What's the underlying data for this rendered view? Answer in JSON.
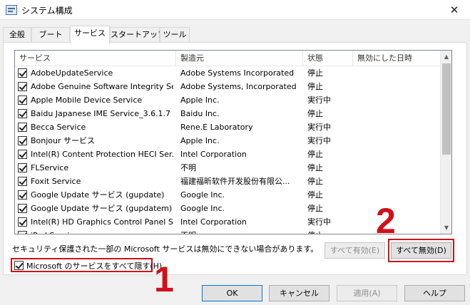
{
  "window": {
    "title": "システム構成",
    "close_glyph": "✕"
  },
  "tabs": [
    {
      "label": "全般"
    },
    {
      "label": "ブート"
    },
    {
      "label": "サービス"
    },
    {
      "label": "スタートアップ"
    },
    {
      "label": "ツール"
    }
  ],
  "list": {
    "columns": [
      "サービス",
      "製造元",
      "状態",
      "無効にした日時"
    ],
    "rows": [
      {
        "checked": true,
        "name": "AdobeUpdateService",
        "manufacturer": "Adobe Systems Incorporated",
        "status": "停止",
        "date": ""
      },
      {
        "checked": true,
        "name": "Adobe Genuine Software Integrity Se...",
        "manufacturer": "Adobe Systems, Incorporated",
        "status": "停止",
        "date": ""
      },
      {
        "checked": true,
        "name": "Apple Mobile Device Service",
        "manufacturer": "Apple Inc.",
        "status": "実行中",
        "date": ""
      },
      {
        "checked": true,
        "name": "Baidu Japanese IME Service_3.6.1.7",
        "manufacturer": "Baidu Inc.",
        "status": "停止",
        "date": ""
      },
      {
        "checked": true,
        "name": "Becca Service",
        "manufacturer": "Rene.E Laboratory",
        "status": "実行中",
        "date": ""
      },
      {
        "checked": true,
        "name": "Bonjour サービス",
        "manufacturer": "Apple Inc.",
        "status": "実行中",
        "date": ""
      },
      {
        "checked": true,
        "name": "Intel(R) Content Protection HECI Ser...",
        "manufacturer": "Intel Corporation",
        "status": "停止",
        "date": ""
      },
      {
        "checked": true,
        "name": "FLService",
        "manufacturer": "不明",
        "status": "停止",
        "date": ""
      },
      {
        "checked": true,
        "name": "Foxit Service",
        "manufacturer": "福建福昕软件开发股份有限公...",
        "status": "停止",
        "date": ""
      },
      {
        "checked": true,
        "name": "Google Update サービス (gupdate)",
        "manufacturer": "Google Inc.",
        "status": "停止",
        "date": ""
      },
      {
        "checked": true,
        "name": "Google Update サービス (gupdatem)",
        "manufacturer": "Google Inc.",
        "status": "停止",
        "date": ""
      },
      {
        "checked": true,
        "name": "Intel(R) HD Graphics Control Panel S...",
        "manufacturer": "Intel Corporation",
        "status": "実行中",
        "date": ""
      },
      {
        "checked": true,
        "name": "iPod Service",
        "manufacturer": "不明",
        "status": "停止",
        "date": ""
      }
    ]
  },
  "notice": "セキュリティ保護された一部の Microsoft サービスは無効にできない場合があります。",
  "buttons": {
    "enable_all": "すべて有効(E)",
    "disable_all": "すべて無効(D)",
    "ok": "OK",
    "cancel": "キャンセル",
    "apply": "適用(A)",
    "help": "ヘルプ"
  },
  "hide_ms": {
    "label": "Microsoft のサービスをすべて隠す(H)",
    "checked": true
  },
  "annotations": {
    "one": "1",
    "two": "2",
    "color": "#d0101a"
  }
}
